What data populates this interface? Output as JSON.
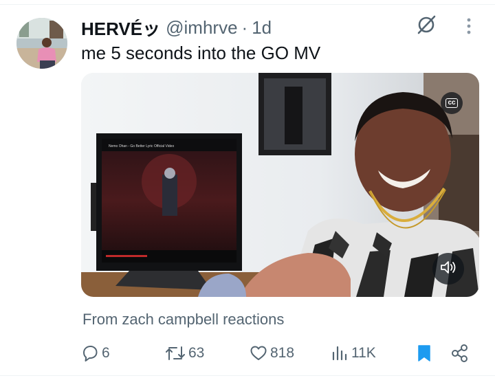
{
  "tweet": {
    "display_name": "HERVÉ",
    "name_emoji": "ッ",
    "handle": "@imhrve",
    "separator": "·",
    "time": "1d",
    "text": "me 5 seconds into the GO MV",
    "media": {
      "cc_label": "cc",
      "tv_title": "Nemo Ohan - Go Better Lyric Official Video"
    },
    "attribution": {
      "prefix": "From",
      "source": "zach campbell reactions"
    },
    "actions": {
      "replies": "6",
      "reposts": "63",
      "likes": "818",
      "views": "11K"
    }
  },
  "colors": {
    "text_primary": "#0f1419",
    "text_secondary": "#536471",
    "accent": "#1d9bf0",
    "divider": "#eff3f4"
  },
  "icons": [
    "avatar",
    "grok-icon",
    "more-icon",
    "cc-icon",
    "volume-icon",
    "reply-icon",
    "repost-icon",
    "like-icon",
    "views-icon",
    "bookmark-icon",
    "share-icon"
  ]
}
